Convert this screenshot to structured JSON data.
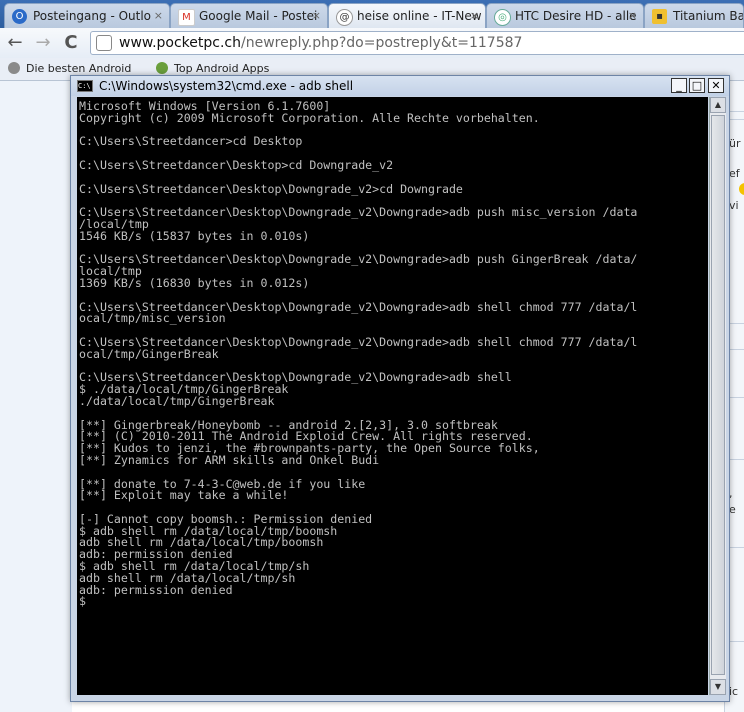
{
  "browser": {
    "tabs": [
      {
        "label": "Posteingang - Outlo",
        "icon": "outlook-icon"
      },
      {
        "label": "Google Mail - Postei",
        "icon": "gmail-icon"
      },
      {
        "label": "heise online - IT-New",
        "icon": "heise-icon"
      },
      {
        "label": "HTC Desire HD - alle",
        "icon": "htc-icon"
      },
      {
        "label": "Titanium Back",
        "icon": "titanium-icon"
      }
    ],
    "close_glyph": "×",
    "back_glyph": "←",
    "forward_glyph": "→",
    "reload_glyph": "C",
    "url_host": "www.pocketpc.ch",
    "url_path": "/newreply.php?do=postreply&t=117587",
    "bookmarks": [
      {
        "label": "Die besten Android"
      },
      {
        "label": "Top Android Apps"
      }
    ]
  },
  "page_right": {
    "snippets": [
      "ür",
      "ef",
      "vi",
      ",",
      "e",
      "ic"
    ]
  },
  "cmd": {
    "title": "C:\\Windows\\system32\\cmd.exe - adb  shell",
    "icon_text": "C:\\",
    "btn_minimize": "_",
    "btn_maximize": "□",
    "btn_close": "✕",
    "scroll_up": "▲",
    "scroll_down": "▼",
    "text": "Microsoft Windows [Version 6.1.7600]\nCopyright (c) 2009 Microsoft Corporation. Alle Rechte vorbehalten.\n\nC:\\Users\\Streetdancer>cd Desktop\n\nC:\\Users\\Streetdancer\\Desktop>cd Downgrade_v2\n\nC:\\Users\\Streetdancer\\Desktop\\Downgrade_v2>cd Downgrade\n\nC:\\Users\\Streetdancer\\Desktop\\Downgrade_v2\\Downgrade>adb push misc_version /data\n/local/tmp\n1546 KB/s (15837 bytes in 0.010s)\n\nC:\\Users\\Streetdancer\\Desktop\\Downgrade_v2\\Downgrade>adb push GingerBreak /data/\nlocal/tmp\n1369 KB/s (16830 bytes in 0.012s)\n\nC:\\Users\\Streetdancer\\Desktop\\Downgrade_v2\\Downgrade>adb shell chmod 777 /data/l\nocal/tmp/misc_version\n\nC:\\Users\\Streetdancer\\Desktop\\Downgrade_v2\\Downgrade>adb shell chmod 777 /data/l\nocal/tmp/GingerBreak\n\nC:\\Users\\Streetdancer\\Desktop\\Downgrade_v2\\Downgrade>adb shell\n$ ./data/local/tmp/GingerBreak\n./data/local/tmp/GingerBreak\n\n[**] Gingerbreak/Honeybomb -- android 2.[2,3], 3.0 softbreak\n[**] (C) 2010-2011 The Android Exploid Crew. All rights reserved.\n[**] Kudos to jenzi, the #brownpants-party, the Open Source folks,\n[**] Zynamics for ARM skills and Onkel Budi\n\n[**] donate to 7-4-3-C@web.de if you like\n[**] Exploit may take a while!\n\n[-] Cannot copy boomsh.: Permission denied\n$ adb shell rm /data/local/tmp/boomsh\nadb shell rm /data/local/tmp/boomsh\nadb: permission denied\n$ adb shell rm /data/local/tmp/sh\nadb shell rm /data/local/tmp/sh\nadb: permission denied\n$"
  }
}
